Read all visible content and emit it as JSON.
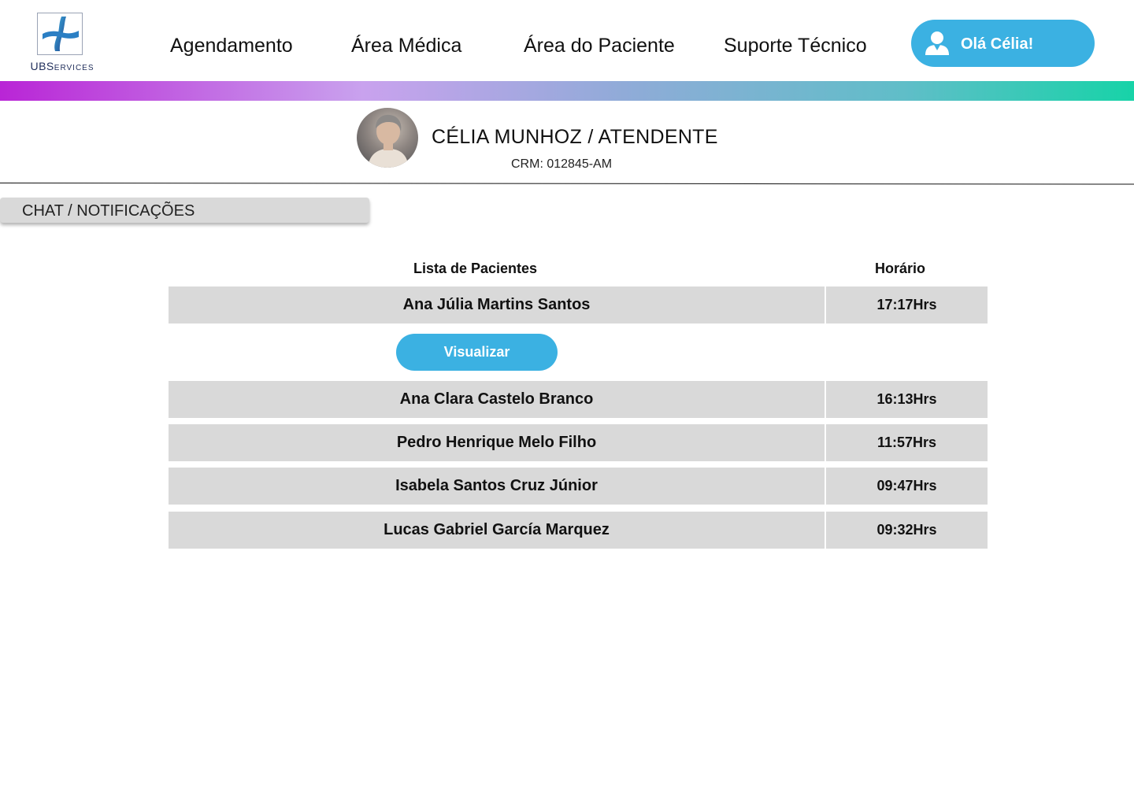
{
  "logo": {
    "brand_main": "UBS",
    "brand_small": "ERVICES"
  },
  "nav": {
    "items": [
      {
        "label": "Agendamento"
      },
      {
        "label": "Área Médica"
      },
      {
        "label": "Área do Paciente"
      },
      {
        "label": "Suporte Técnico"
      }
    ]
  },
  "user": {
    "greeting": "Olá Célia!",
    "icon": "user-icon"
  },
  "profile": {
    "name": "CÉLIA MUNHOZ / ATENDENTE",
    "crm": "CRM: 012845-AM"
  },
  "chat_tab": {
    "label": "CHAT / NOTIFICAÇÕES"
  },
  "table": {
    "headers": {
      "patients": "Lista de Pacientes",
      "time": "Horário"
    },
    "rows": [
      {
        "name": "Ana Júlia Martins Santos",
        "time": "17:17Hrs"
      },
      {
        "name": "Ana Clara Castelo Branco",
        "time": "16:13Hrs"
      },
      {
        "name": "Pedro Henrique Melo Filho",
        "time": "11:57Hrs"
      },
      {
        "name": "Isabela Santos Cruz Júnior",
        "time": "09:47Hrs"
      },
      {
        "name": "Lucas Gabriel García Marquez",
        "time": "09:32Hrs"
      }
    ],
    "view_button": "Visualizar"
  },
  "colors": {
    "accent": "#3bb1e2",
    "row_bg": "#d9d9d9",
    "gradient_start": "#b925d6",
    "gradient_end": "#17d3a8"
  }
}
